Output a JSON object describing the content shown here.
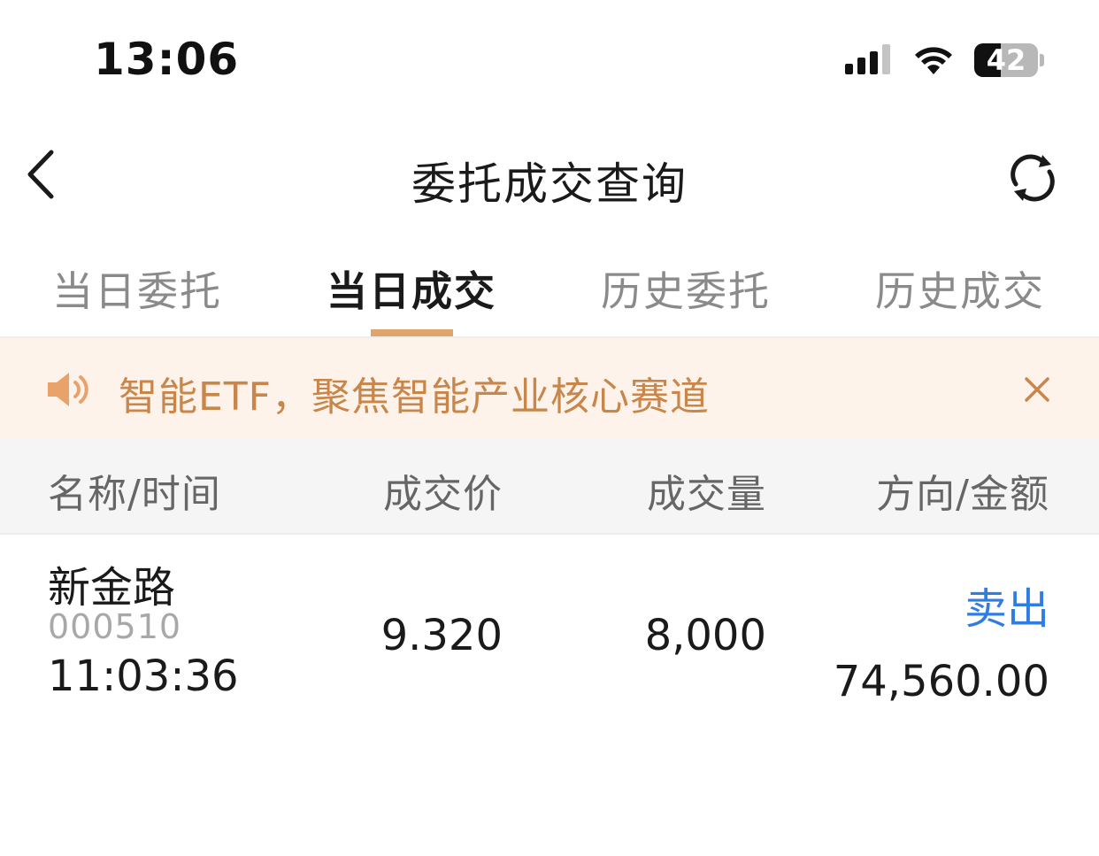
{
  "status_bar": {
    "time": "13:06",
    "battery": "42",
    "icons": [
      "signal-icon",
      "wifi-icon",
      "battery-icon"
    ]
  },
  "nav": {
    "title": "委托成交查询",
    "back_icon": "chevron-left-icon",
    "refresh_icon": "refresh-icon"
  },
  "tabs": [
    {
      "label": "当日委托",
      "active": false
    },
    {
      "label": "当日成交",
      "active": true
    },
    {
      "label": "历史委托",
      "active": false
    },
    {
      "label": "历史成交",
      "active": false
    }
  ],
  "notice": {
    "text": "智能ETF，聚焦智能产业核心赛道",
    "icon": "speaker-icon",
    "close_icon": "close-icon"
  },
  "table": {
    "headers": [
      "名称/时间",
      "成交价",
      "成交量",
      "方向/金额"
    ],
    "rows": [
      {
        "name": "新金路",
        "code": "000510",
        "time": "11:03:36",
        "price": "9.320",
        "volume": "8,000",
        "direction": "卖出",
        "amount": "74,560.00"
      }
    ]
  },
  "colors": {
    "accent": "#e0a56c",
    "notice_bg": "#fdf3ea",
    "notice_text": "#c8864a",
    "sell": "#2f7de1"
  }
}
